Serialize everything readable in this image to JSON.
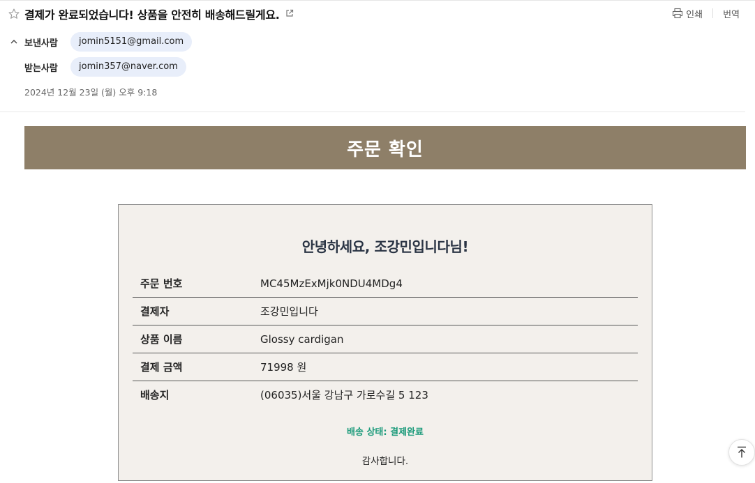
{
  "header": {
    "subject": "결제가 완료되었습니다! 상품을 안전히 배송해드릴게요.",
    "print_label": "인쇄",
    "translate_label": "번역"
  },
  "meta": {
    "sender_label": "보낸사람",
    "sender_email": "jomin5151@gmail.com",
    "recipient_label": "받는사람",
    "recipient_email": "jomin357@naver.com",
    "date": "2024년 12월 23일 (월) 오후 9:18"
  },
  "email": {
    "banner_title": "주문 확인",
    "greeting": "안녕하세요, 조강민입니다님!",
    "rows": [
      {
        "label": "주문 번호",
        "value": "MC45MzExMjk0NDU4MDg4"
      },
      {
        "label": "결제자",
        "value": "조강민입니다"
      },
      {
        "label": "상품 이름",
        "value": "Glossy cardigan"
      },
      {
        "label": "결제 금액",
        "value": "71998 원"
      },
      {
        "label": "배송지",
        "value": "(06035)서울 강남구 가로수길 5 123"
      }
    ],
    "status": "배송 상태: 결제완료",
    "thanks": "감사합니다."
  },
  "colors": {
    "banner": "#8e7f68",
    "card_bg": "#f3f0ec",
    "status": "#1a9a7a",
    "chip": "#e8eefa"
  },
  "icons": {
    "star": "star-icon",
    "popout": "external-link-icon",
    "print": "printer-icon",
    "collapse": "chevron-up-icon",
    "scroll_top": "arrow-to-top-icon"
  }
}
